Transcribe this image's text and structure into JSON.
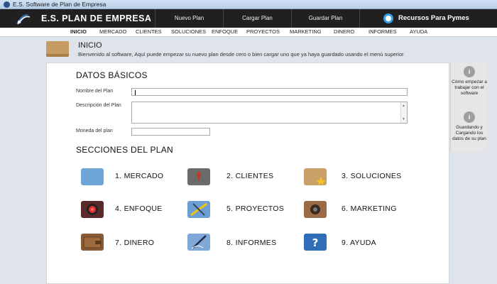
{
  "window": {
    "title": "E.S. Software de Plan de Empresa"
  },
  "header": {
    "app_title": "E.S. PLAN DE EMPRESA",
    "nav": [
      "Nuevo Plan",
      "Cargar Plan",
      "Guardar Plan"
    ],
    "recursos": "Recursos Para Pymes"
  },
  "menu": [
    "INICIO",
    "MERCADO",
    "CLIENTES",
    "SOLUCIONES",
    "ENFOQUE",
    "PROYECTOS",
    "MARKETING",
    "DINERO",
    "INFORMES",
    "AYUDA"
  ],
  "section": {
    "title": "INICIO",
    "description": "Bienvenido al software, Aquí puede empezar su nuevo plan desde cero o bien cargar uno que ya haya guardado usando el menú superior"
  },
  "datos": {
    "heading": "DATOS BÁSICOS",
    "nombre_label": "Nombre del Plan",
    "nombre_value": "",
    "descripcion_label": "Descripción del Plan",
    "descripcion_value": "",
    "moneda_label": "Moneda del plan",
    "moneda_value": ""
  },
  "secciones": {
    "heading": "SECCIONES DEL PLAN",
    "items": [
      {
        "label": "1. MERCADO",
        "icon": "world-map-icon",
        "color": "#6fa6d8"
      },
      {
        "label": "2. CLIENTES",
        "icon": "client-suit-icon",
        "color": "#6b6b6b"
      },
      {
        "label": "3. SOLUCIONES",
        "icon": "box-star-icon",
        "color": "#c9a067"
      },
      {
        "label": "4. ENFOQUE",
        "icon": "target-icon",
        "color": "#5a2a2a"
      },
      {
        "label": "5. PROYECTOS",
        "icon": "drafting-tools-icon",
        "color": "#6c9fd3"
      },
      {
        "label": "6. MARKETING",
        "icon": "speaker-icon",
        "color": "#9c6a45"
      },
      {
        "label": "7. DINERO",
        "icon": "wallet-icon",
        "color": "#8a5a35"
      },
      {
        "label": "8. INFORMES",
        "icon": "pen-document-icon",
        "color": "#7fa7d8"
      },
      {
        "label": "9. AYUDA",
        "icon": "question-icon",
        "color": "#2f6db8"
      }
    ]
  },
  "sidebar": {
    "help1": "Cómo empezar a trabajar con el software",
    "help2": "Guardando y Cargando los datos de su plan",
    "icon_glyph": "i"
  }
}
